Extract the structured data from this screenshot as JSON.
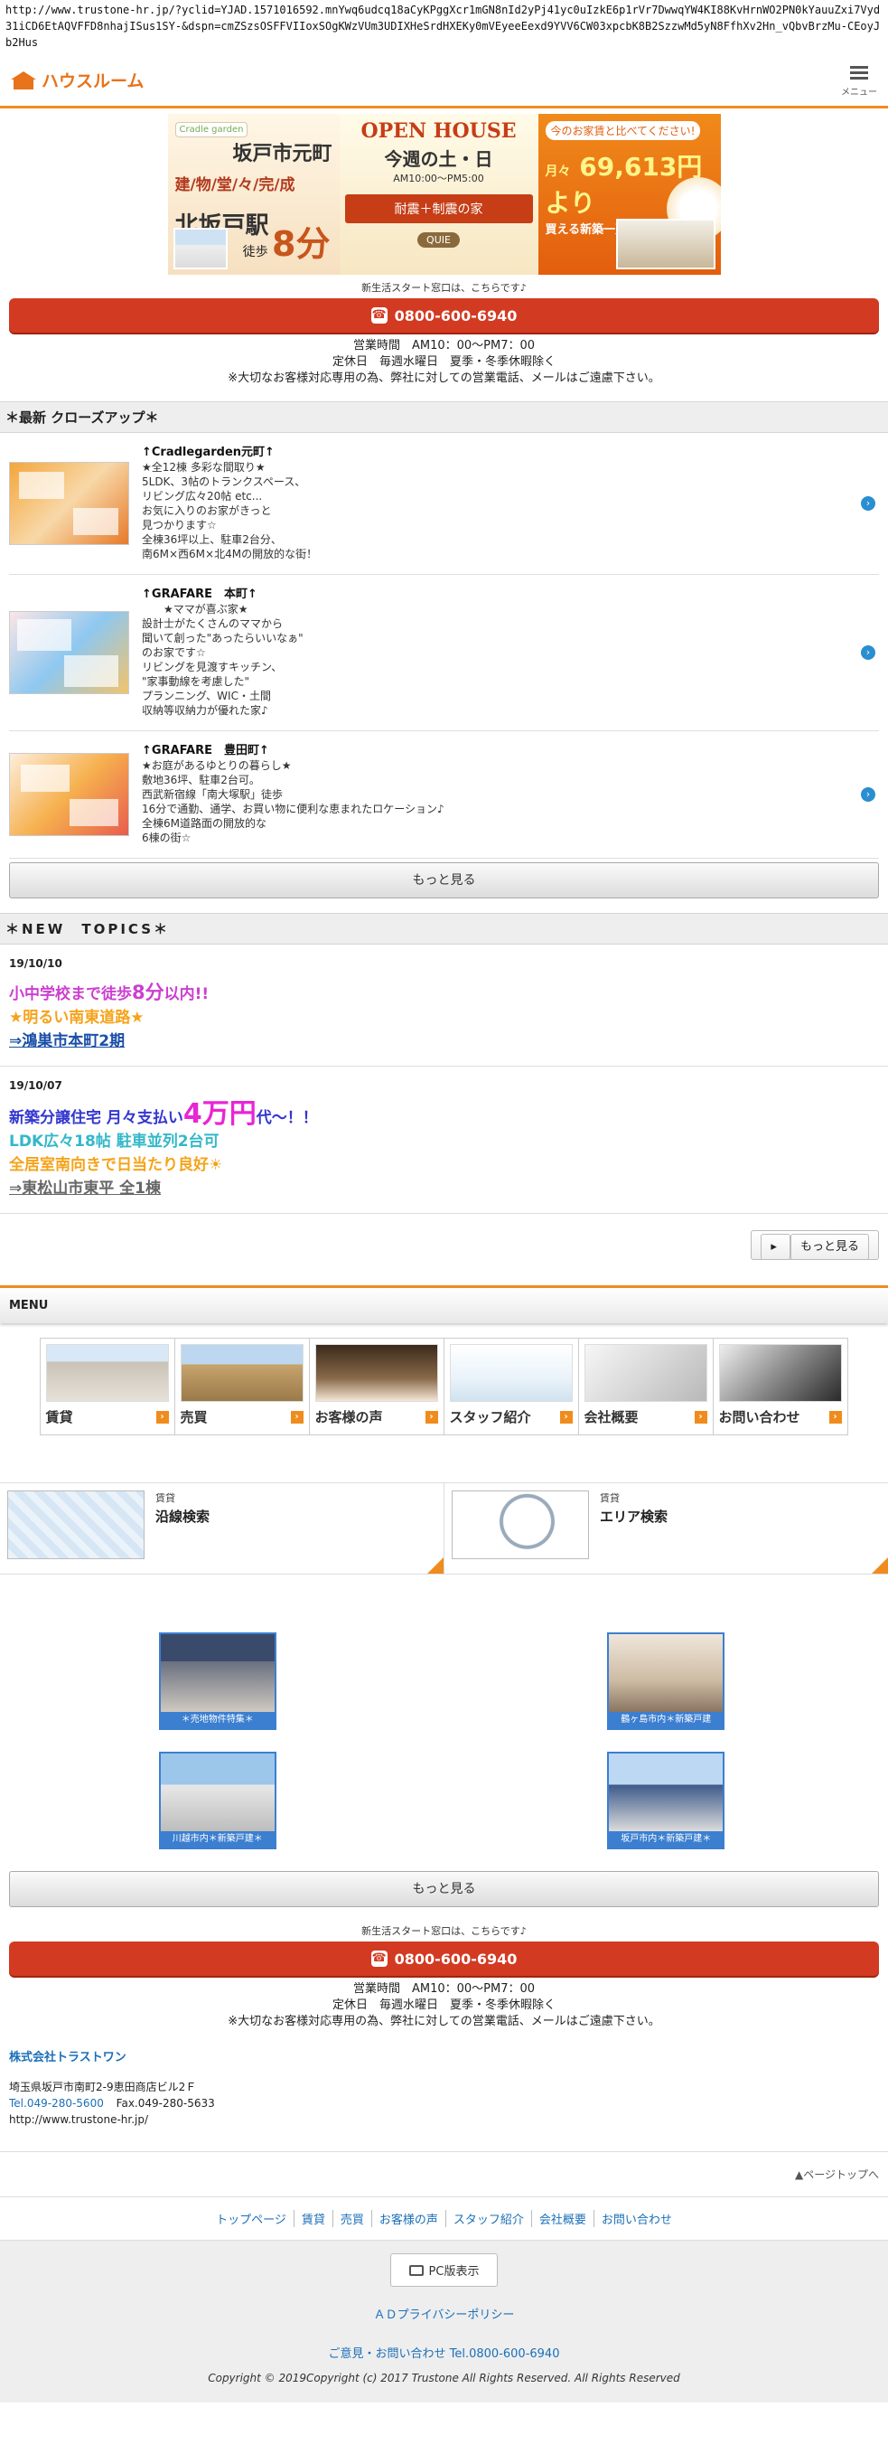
{
  "browser": {
    "url": "http://www.trustone-hr.jp/?yclid=YJAD.1571016592.mnYwq6udcq18aCyKPggXcr1mGN8nId2yPj41yc0uIzkE6p1rVr7DwwqYW4KI88KvHrnWO2PN0kYauuZxi7Vyd31iCD6EtAQVFFD8nhajISus1SY-&dspn=cmZSzsOSFFVIIoxSOgKWzVUm3UDIXHeSrdHXEKy0mVEyeeEexd9YVV6CW03xpcbK8B2SzzwMd5yN8FfhXv2Hn_vQbvBrzMu-CEoyJb2Hus"
  },
  "header": {
    "logo_text": "ハウスルーム",
    "menu_label": "メニュー"
  },
  "banner": {
    "brand": "Cradle garden",
    "town": "坂戸市元町",
    "tagline": "建/物/堂/々/完/成",
    "station": "北坂戸駅",
    "walk_prefix": "徒歩",
    "walk_minutes": "8分",
    "open_house": "OPEN HOUSE",
    "week_text": "今週の土・日",
    "hours": "AM10:00〜PM5:00",
    "feature_badge": "耐震＋制震の家",
    "quie": "QUIE",
    "compare_text": "今のお家賃と比べてください!",
    "price_prefix": "月々",
    "price": "69,613円より",
    "price_sub": "買える新築一戸建て"
  },
  "contact_top": {
    "note": "新生活スタート窓口は、こちらです♪",
    "tel": "0800-600-6940",
    "hours": "営業時間　AM10：00〜PM7：00",
    "closed": "定休日　毎週水曜日　夏季・冬季休暇除く",
    "notice": "※大切なお客様対応専用の為、弊社に対しての営業電話、メールはご遠慮下さい。"
  },
  "closeup": {
    "heading": "＊最新 クローズアップ＊",
    "items": [
      {
        "title": "↑Cradlegarden元町↑",
        "lines": [
          "★全12棟 多彩な間取り★",
          "5LDK、3帖のトランクスペース、",
          "リビング広々20帖 etc...",
          "お気に入りのお家がきっと",
          "見つかります☆",
          "全棟36坪以上、駐車2台分、",
          "南6M×西6M×北4Mの開放的な街！"
        ]
      },
      {
        "title": "↑GRAFARE　本町↑",
        "lines": [
          "　　★ママが喜ぶ家★",
          "設計士がたくさんのママから",
          "聞いて創った\"あったらいいなぁ\"",
          "のお家です☆",
          "リビングを見渡すキッチン、",
          "\"家事動線を考慮した\"",
          "プランニング、WIC・土間",
          "収納等収納力が優れた家♪"
        ]
      },
      {
        "title": "↑GRAFARE　豊田町↑",
        "lines": [
          "★お庭があるゆとりの暮らし★",
          "敷地36坪、駐車2台可。",
          "西武新宿線「南大塚駅」徒歩",
          "16分で通勤、通学、お買い物に便利な恵まれたロケーション♪",
          "全棟6M道路面の開放的な",
          "6棟の街☆"
        ]
      }
    ],
    "more_label": "もっと見る"
  },
  "topics": {
    "heading": "＊NEW　TOPICS＊",
    "items": [
      {
        "date": "19/10/10",
        "line1_a": "小中学校まで徒歩",
        "line1_b": "8分",
        "line1_c": "以内!!",
        "line2": "★明るい南東道路★",
        "link": "⇒鴻巣市本町2期"
      },
      {
        "date": "19/10/07",
        "line1_a": "新築分譲住宅 月々支払い",
        "line1_b": "4万円",
        "line1_c": "代〜！！",
        "line2": "LDK広々18帖 駐車並列2台可",
        "line3": "全居室南向きで日当たり良好☀",
        "link": "⇒東松山市東平 全1棟"
      }
    ],
    "more_label": "もっと見る"
  },
  "menu": {
    "heading": "MENU",
    "tiles": [
      {
        "label": "賃貸"
      },
      {
        "label": "売買"
      },
      {
        "label": "お客様の声"
      },
      {
        "label": "スタッフ紹介"
      },
      {
        "label": "会社概要"
      },
      {
        "label": "お問い合わせ"
      }
    ]
  },
  "search": {
    "line": {
      "category": "賃貸",
      "name": "沿線検索"
    },
    "area": {
      "category": "賃貸",
      "name": "エリア検索"
    }
  },
  "features": [
    {
      "label": "＊売地物件特集＊"
    },
    {
      "label": "鶴ヶ島市内＊新築戸建"
    },
    {
      "label": "川越市内＊新築戸建＊"
    },
    {
      "label": "坂戸市内＊新築戸建＊"
    }
  ],
  "features_more": "もっと見る",
  "contact_bottom": {
    "note": "新生活スタート窓口は、こちらです♪",
    "tel": "0800-600-6940",
    "hours": "営業時間　AM10：00〜PM7：00",
    "closed": "定休日　毎週水曜日　夏季・冬季休暇除く",
    "notice": "※大切なお客様対応専用の為、弊社に対しての営業電話、メールはご遠慮下さい。"
  },
  "company": {
    "name": "株式会社トラストワン",
    "address": "埼玉県坂戸市南町2-9恵田商店ビル2Ｆ",
    "tel_label": "Tel.",
    "tel": "049-280-5600",
    "fax": "Fax.049-280-5633",
    "url": "http://www.trustone-hr.jp/"
  },
  "pagetop": "▲ページトップへ",
  "footer_nav": [
    "トップページ",
    "賃貸",
    "売買",
    "お客様の声",
    "スタッフ紹介",
    "会社概要",
    "お問い合わせ"
  ],
  "footer": {
    "pc_label": "PC版表示",
    "privacy": "ＡＤプライバシーポリシー",
    "contact_prefix": "ご意見・お問い合わせ Tel.",
    "contact_tel": "0800-600-6940",
    "copyright": "Copyright © 2019Copyright (c) 2017 Trustone All Rights Reserved. All Rights Reserved"
  },
  "colors": {
    "accent": "#f08c1e",
    "tel_button": "#d33a22",
    "link": "#1b6fb8"
  }
}
